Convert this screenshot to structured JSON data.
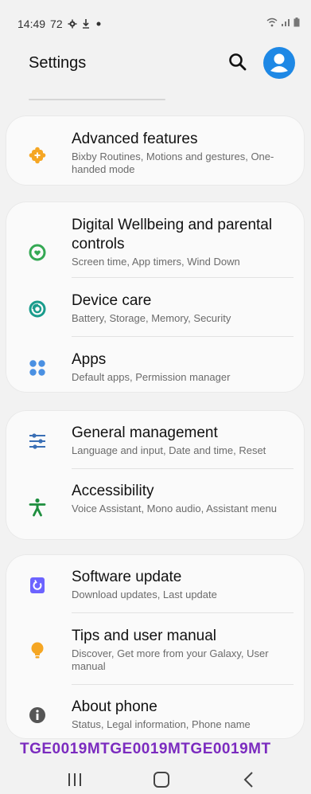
{
  "status_bar": {
    "time": "14:49",
    "temp": "72",
    "icons": [
      "gear-icon",
      "download-icon",
      "dot-icon",
      "wifi-icon",
      "signal-icon",
      "battery-icon"
    ]
  },
  "header": {
    "title": "Settings",
    "search_icon": "search-icon",
    "account_icon": "account-icon"
  },
  "groups": [
    {
      "items": [
        {
          "title": "Advanced features",
          "subtitle": "Bixby Routines, Motions and gestures, One-handed mode",
          "icon": "plus-puzzle-icon",
          "color": "#f5a623"
        }
      ]
    },
    {
      "items": [
        {
          "title": "Digital Wellbeing and parental controls",
          "subtitle": "Screen time, App timers, Wind Down",
          "icon": "wellbeing-icon",
          "color": "#34a853"
        },
        {
          "title": "Device care",
          "subtitle": "Battery, Storage, Memory, Security",
          "icon": "device-care-icon",
          "color": "#1a9c8c"
        },
        {
          "title": "Apps",
          "subtitle": "Default apps, Permission manager",
          "icon": "apps-icon",
          "color": "#4a90e2"
        }
      ]
    },
    {
      "items": [
        {
          "title": "General management",
          "subtitle": "Language and input, Date and time, Reset",
          "icon": "sliders-icon",
          "color": "#3a6fb5"
        },
        {
          "title": "Accessibility",
          "subtitle": "Voice Assistant, Mono audio, Assistant menu",
          "icon": "accessibility-icon",
          "color": "#1e8e3e"
        }
      ]
    },
    {
      "items": [
        {
          "title": "Software update",
          "subtitle": "Download updates, Last update",
          "icon": "software-update-icon",
          "color": "#6c63ff"
        },
        {
          "title": "Tips and user manual",
          "subtitle": "Discover, Get more from your Galaxy, User manual",
          "icon": "lightbulb-icon",
          "color": "#f5a623"
        },
        {
          "title": "About phone",
          "subtitle": "Status, Legal information, Phone name",
          "icon": "info-icon",
          "color": "#555555"
        }
      ]
    }
  ],
  "watermark": "TGE0019MTGE0019MTGE0019MT",
  "navbar": {
    "recent_icon": "recent-apps-icon",
    "home_icon": "home-icon",
    "back_icon": "back-icon"
  }
}
